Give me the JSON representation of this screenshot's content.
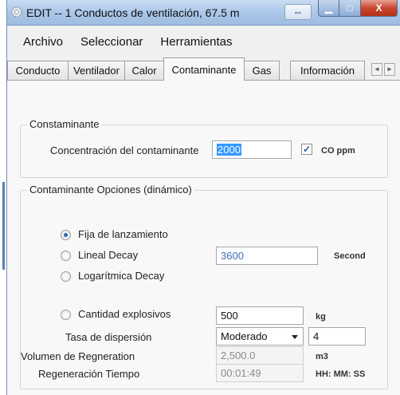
{
  "window": {
    "title": "EDIT -- 1 Conductos de ventilación, 67.5 m",
    "resize_glyph": "⇔",
    "min_glyph": "▁",
    "max_glyph": "□",
    "close_glyph": "X"
  },
  "menu": {
    "items": [
      "Archivo",
      "Seleccionar",
      "Herramientas"
    ]
  },
  "tabs": {
    "items": [
      "Conducto",
      "Ventilador",
      "Calor",
      "Contaminante",
      "Gas",
      "Información"
    ],
    "active": "Contaminante",
    "scroll_left": "◄",
    "scroll_right": "►"
  },
  "contaminant": {
    "group_title": "Constaminante",
    "concentration_label": "Concentración del contaminante",
    "concentration_value": "2000",
    "checkbox_checked": true,
    "checkbox_glyph": "✓",
    "unit": "CO ppm"
  },
  "options": {
    "group_title": "Contaminante Opciones (dinámico)",
    "radio_fixed": "Fija de lanzamiento",
    "radio_linear": "Lineal Decay",
    "linear_value": "3600",
    "linear_unit": "Second",
    "radio_log": "Logarítmica Decay",
    "radio_explosive": "Cantidad explosivos",
    "explosive_value": "500",
    "explosive_unit": "kg",
    "dispersion_label": "Tasa de dispersión",
    "dispersion_value": "Moderado",
    "dispersion_number": "4",
    "regen_volume_label": "Volumen de Regneration",
    "regen_volume_value": "2,500.0",
    "regen_volume_unit": "m3",
    "regen_time_label": "Regeneración Tiempo",
    "regen_time_value": "00:01:49",
    "regen_time_unit": "HH: MM: SS"
  },
  "colors": {
    "selection": "#3399ff",
    "close_button": "#c9462f",
    "radio_selected": "#2b63b5"
  }
}
